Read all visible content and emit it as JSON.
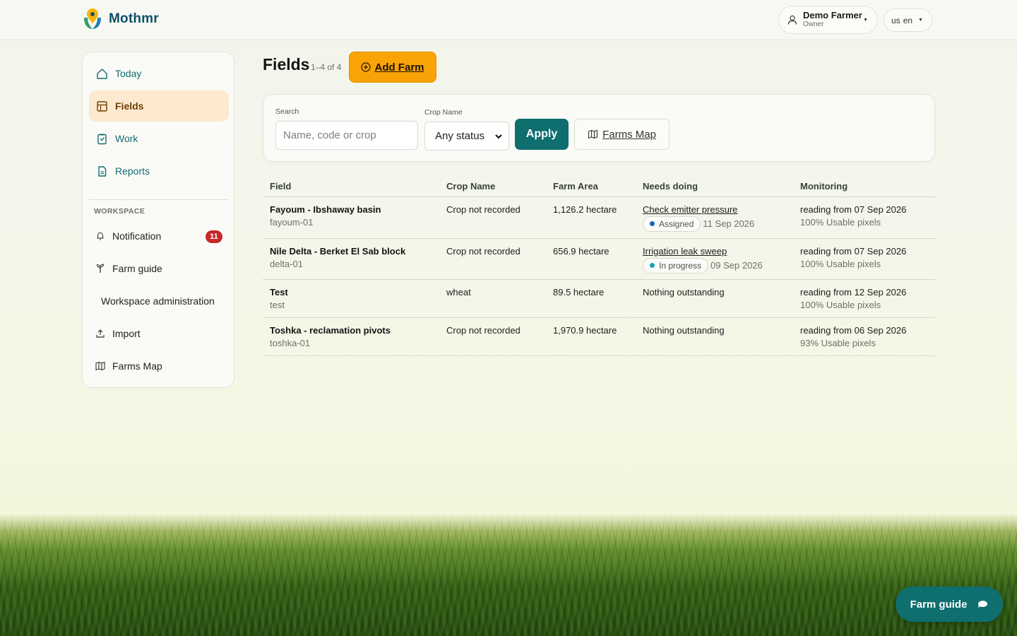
{
  "app": {
    "name": "Mothmr"
  },
  "user": {
    "name": "Demo Farmer",
    "role": "Owner",
    "locale_region": "us",
    "locale_lang": "en"
  },
  "nav": [
    {
      "label": "Today",
      "icon": "home-icon"
    },
    {
      "label": "Fields",
      "icon": "grid-icon",
      "active": true
    },
    {
      "label": "Work",
      "icon": "clipboard-icon"
    },
    {
      "label": "Reports",
      "icon": "document-icon"
    }
  ],
  "workspace": {
    "title": "WORKSPACE",
    "items": [
      {
        "label": "Notification",
        "icon": "bell-icon",
        "badge": "11"
      },
      {
        "label": "Farm guide",
        "icon": "sprout-icon"
      },
      {
        "label": "Workspace administration"
      },
      {
        "label": "Import",
        "icon": "upload-icon"
      },
      {
        "label": "Farms Map",
        "icon": "map-icon"
      }
    ]
  },
  "page": {
    "title": "Fields",
    "count": "1–4 of 4",
    "add_label": "Add Farm"
  },
  "filters": {
    "search_label": "Search",
    "search_placeholder": "Name, code or crop",
    "crop_label": "Crop Name",
    "status_value": "Any status",
    "apply_label": "Apply",
    "map_label": "Farms Map"
  },
  "table": {
    "columns": [
      "Field",
      "Crop Name",
      "Farm Area",
      "Needs doing",
      "Monitoring"
    ],
    "rows": [
      {
        "name": "Fayoum - Ibshaway basin",
        "code": "fayoum-01",
        "crop": "Crop not recorded",
        "area": "1,126.2 hectare",
        "task": "Check emitter pressure",
        "status": "Assigned",
        "due": "11 Sep 2026",
        "reading": "reading from 07 Sep 2026",
        "pixels": "100% Usable pixels"
      },
      {
        "name": "Nile Delta - Berket El Sab block",
        "code": "delta-01",
        "crop": "Crop not recorded",
        "area": "656.9 hectare",
        "task": "Irrigation leak sweep",
        "status": "In progress",
        "due": "09 Sep 2026",
        "reading": "reading from 07 Sep 2026",
        "pixels": "100% Usable pixels"
      },
      {
        "name": "Test",
        "code": "test",
        "crop": "wheat",
        "area": "89.5 hectare",
        "none": "Nothing outstanding",
        "reading": "reading from 12 Sep 2026",
        "pixels": "100% Usable pixels"
      },
      {
        "name": "Toshka - reclamation pivots",
        "code": "toshka-01",
        "crop": "Crop not recorded",
        "area": "1,970.9 hectare",
        "none": "Nothing outstanding",
        "reading": "reading from 06 Sep 2026",
        "pixels": "93% Usable pixels"
      }
    ]
  },
  "colors": {
    "brand": "#0f5066",
    "accent": "#0f6e6e",
    "add": "#f9a306",
    "assigned": "#1565c0",
    "in_progress": "#14a4b8",
    "badge": "#c62828"
  },
  "chat": {
    "label": "Farm guide"
  }
}
